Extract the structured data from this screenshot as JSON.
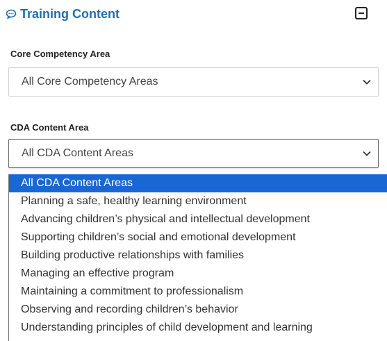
{
  "header": {
    "title": "Training Content",
    "icon": "chat-bubble-icon",
    "accent_color": "#1f6fb2"
  },
  "core_competency": {
    "label": "Core Competency Area",
    "selected": "All Core Competency Areas"
  },
  "cda_content": {
    "label": "CDA Content Area",
    "selected": "All CDA Content Areas",
    "options": [
      "All CDA Content Areas",
      "Planning a safe, healthy learning environment",
      "Advancing children’s physical and intellectual development",
      "Supporting children’s social and emotional development",
      "Building productive relationships with families",
      "Managing an effective program",
      "Maintaining a commitment to professionalism",
      "Observing and recording children’s behavior",
      "Understanding principles of child development and learning"
    ],
    "highlight_color": "#1967d2"
  }
}
